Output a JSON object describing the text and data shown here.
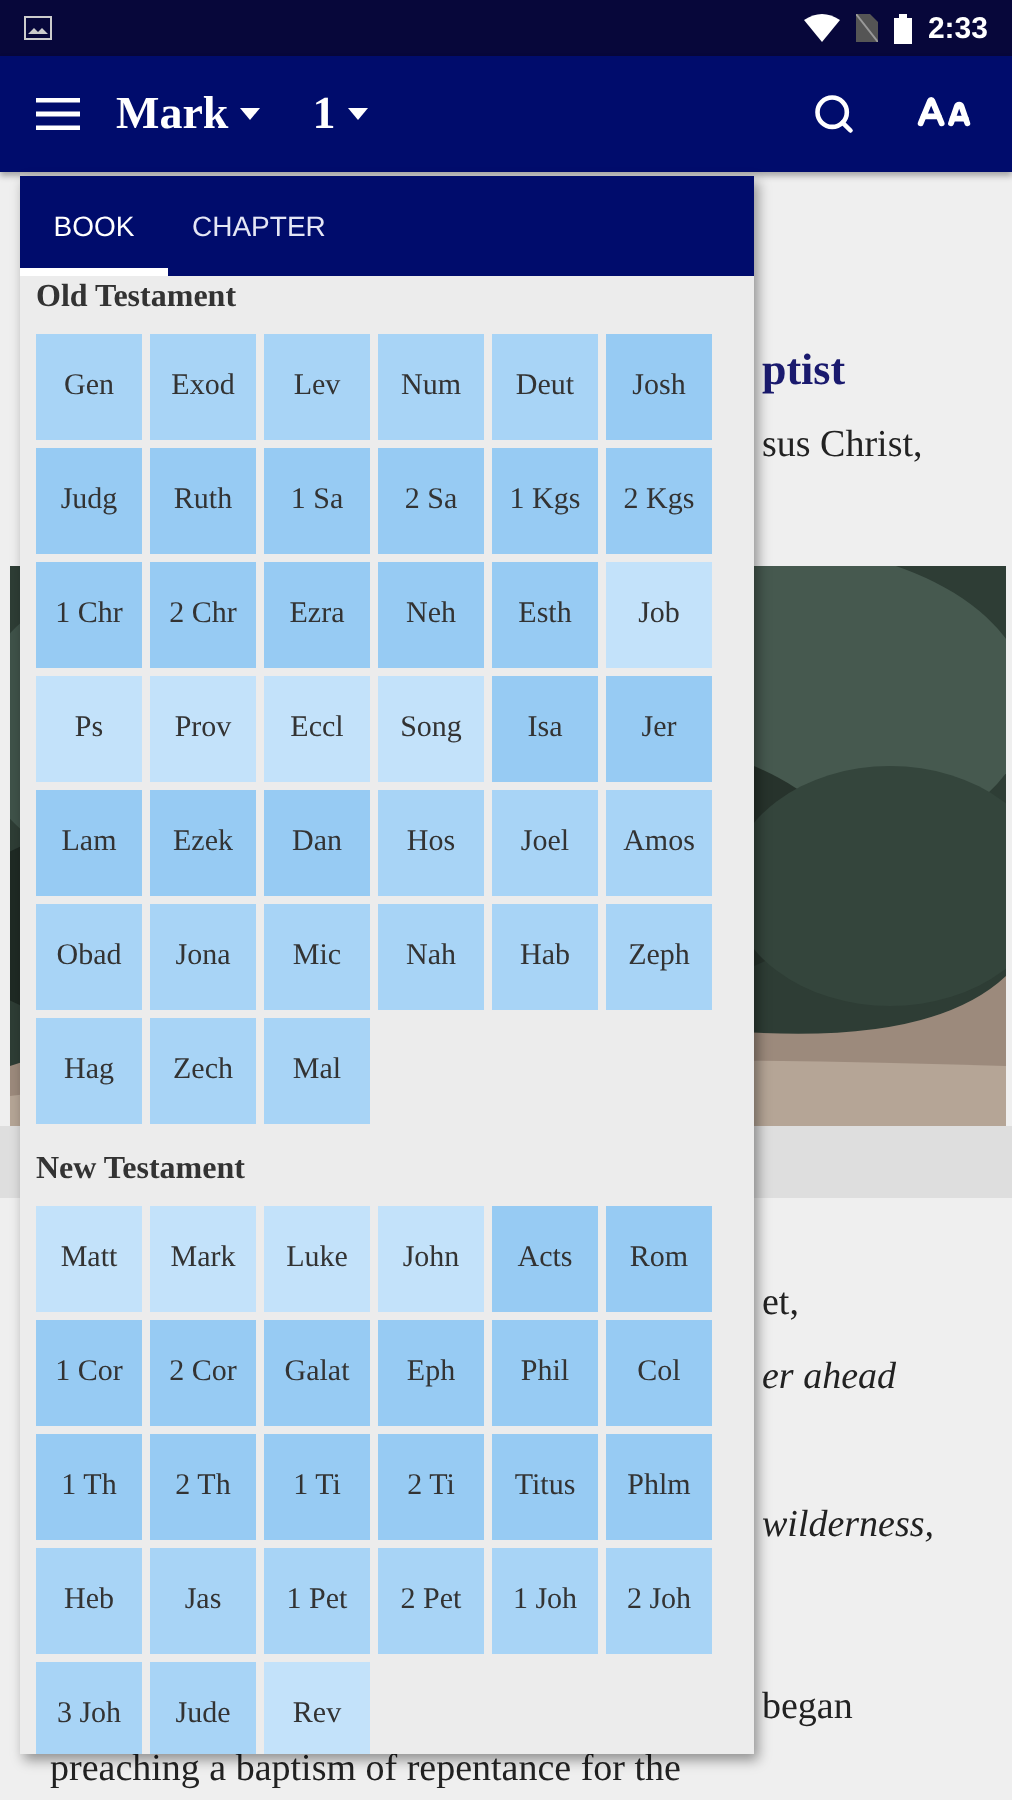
{
  "status_bar": {
    "time": "2:33"
  },
  "app_bar": {
    "book": "Mark",
    "chapter": "1"
  },
  "background": {
    "heading": "ptist",
    "lines": [
      {
        "text": "sus Christ,",
        "kind": "plain"
      },
      {
        "text": "et,",
        "kind": "plain"
      },
      {
        "text": "er ahead",
        "kind": "italic"
      },
      {
        "text": "wilderness,",
        "kind": "italic"
      },
      {
        "text": "began",
        "kind": "plain"
      }
    ],
    "tail": [
      "preaching a baptism of repentance for the"
    ]
  },
  "picker": {
    "tabs": [
      {
        "label": "BOOK",
        "selected": true
      },
      {
        "label": "CHAPTER",
        "selected": false
      }
    ],
    "sections": [
      {
        "title": "Old Testament",
        "books": [
          {
            "label": "Gen",
            "color": "#a8d4f6"
          },
          {
            "label": "Exod",
            "color": "#a8d4f6"
          },
          {
            "label": "Lev",
            "color": "#a8d4f6"
          },
          {
            "label": "Num",
            "color": "#a8d4f6"
          },
          {
            "label": "Deut",
            "color": "#a8d4f6"
          },
          {
            "label": "Josh",
            "color": "#97cbf3"
          },
          {
            "label": "Judg",
            "color": "#97cbf3"
          },
          {
            "label": "Ruth",
            "color": "#97cbf3"
          },
          {
            "label": "1 Sa",
            "color": "#97cbf3"
          },
          {
            "label": "2 Sa",
            "color": "#97cbf3"
          },
          {
            "label": "1 Kgs",
            "color": "#97cbf3"
          },
          {
            "label": "2 Kgs",
            "color": "#97cbf3"
          },
          {
            "label": "1 Chr",
            "color": "#97cbf3"
          },
          {
            "label": "2 Chr",
            "color": "#97cbf3"
          },
          {
            "label": "Ezra",
            "color": "#97cbf3"
          },
          {
            "label": "Neh",
            "color": "#97cbf3"
          },
          {
            "label": "Esth",
            "color": "#97cbf3"
          },
          {
            "label": "Job",
            "color": "#c3e2fa"
          },
          {
            "label": "Ps",
            "color": "#c3e2fa"
          },
          {
            "label": "Prov",
            "color": "#c3e2fa"
          },
          {
            "label": "Eccl",
            "color": "#c3e2fa"
          },
          {
            "label": "Song",
            "color": "#c3e2fa"
          },
          {
            "label": "Isa",
            "color": "#97cbf3"
          },
          {
            "label": "Jer",
            "color": "#97cbf3"
          },
          {
            "label": "Lam",
            "color": "#97cbf3"
          },
          {
            "label": "Ezek",
            "color": "#97cbf3"
          },
          {
            "label": "Dan",
            "color": "#97cbf3"
          },
          {
            "label": "Hos",
            "color": "#a8d4f6"
          },
          {
            "label": "Joel",
            "color": "#a8d4f6"
          },
          {
            "label": "Amos",
            "color": "#a8d4f6"
          },
          {
            "label": "Obad",
            "color": "#a8d4f6"
          },
          {
            "label": "Jona",
            "color": "#a8d4f6"
          },
          {
            "label": "Mic",
            "color": "#a8d4f6"
          },
          {
            "label": "Nah",
            "color": "#a8d4f6"
          },
          {
            "label": "Hab",
            "color": "#a8d4f6"
          },
          {
            "label": "Zeph",
            "color": "#a8d4f6"
          },
          {
            "label": "Hag",
            "color": "#a8d4f6"
          },
          {
            "label": "Zech",
            "color": "#a8d4f6"
          },
          {
            "label": "Mal",
            "color": "#a8d4f6"
          }
        ]
      },
      {
        "title": "New Testament",
        "books": [
          {
            "label": "Matt",
            "color": "#c3e2fa"
          },
          {
            "label": "Mark",
            "color": "#c3e2fa"
          },
          {
            "label": "Luke",
            "color": "#c3e2fa"
          },
          {
            "label": "John",
            "color": "#c3e2fa"
          },
          {
            "label": "Acts",
            "color": "#97cbf3"
          },
          {
            "label": "Rom",
            "color": "#97cbf3"
          },
          {
            "label": "1 Cor",
            "color": "#97cbf3"
          },
          {
            "label": "2 Cor",
            "color": "#97cbf3"
          },
          {
            "label": "Galat",
            "color": "#97cbf3"
          },
          {
            "label": "Eph",
            "color": "#97cbf3"
          },
          {
            "label": "Phil",
            "color": "#97cbf3"
          },
          {
            "label": "Col",
            "color": "#97cbf3"
          },
          {
            "label": "1 Th",
            "color": "#97cbf3"
          },
          {
            "label": "2 Th",
            "color": "#97cbf3"
          },
          {
            "label": "1 Ti",
            "color": "#97cbf3"
          },
          {
            "label": "2 Ti",
            "color": "#97cbf3"
          },
          {
            "label": "Titus",
            "color": "#97cbf3"
          },
          {
            "label": "Phlm",
            "color": "#97cbf3"
          },
          {
            "label": "Heb",
            "color": "#a8d4f6"
          },
          {
            "label": "Jas",
            "color": "#a8d4f6"
          },
          {
            "label": "1 Pet",
            "color": "#a8d4f6"
          },
          {
            "label": "2 Pet",
            "color": "#a8d4f6"
          },
          {
            "label": "1 Joh",
            "color": "#a8d4f6"
          },
          {
            "label": "2 Joh",
            "color": "#a8d4f6"
          },
          {
            "label": "3 Joh",
            "color": "#a8d4f6"
          },
          {
            "label": "Jude",
            "color": "#a8d4f6"
          },
          {
            "label": "Rev",
            "color": "#c3e2fa"
          }
        ]
      }
    ]
  }
}
